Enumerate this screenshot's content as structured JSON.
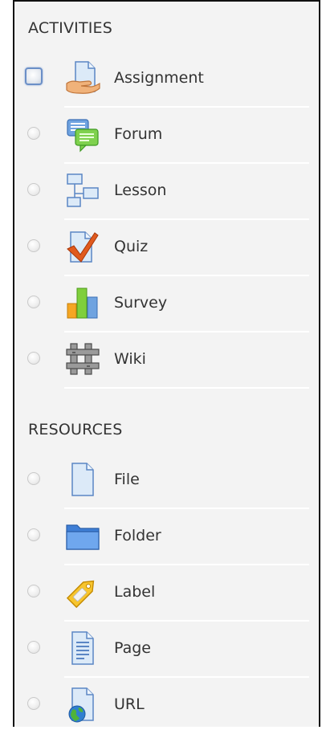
{
  "sections": {
    "activities": {
      "header": "ACTIVITIES",
      "items": [
        {
          "label": "Assignment",
          "icon": "assignment-icon",
          "selected": true
        },
        {
          "label": "Forum",
          "icon": "forum-icon",
          "selected": false
        },
        {
          "label": "Lesson",
          "icon": "lesson-icon",
          "selected": false
        },
        {
          "label": "Quiz",
          "icon": "quiz-icon",
          "selected": false
        },
        {
          "label": "Survey",
          "icon": "survey-icon",
          "selected": false
        },
        {
          "label": "Wiki",
          "icon": "wiki-icon",
          "selected": false
        }
      ]
    },
    "resources": {
      "header": "RESOURCES",
      "items": [
        {
          "label": "File",
          "icon": "file-icon",
          "selected": false
        },
        {
          "label": "Folder",
          "icon": "folder-icon",
          "selected": false
        },
        {
          "label": "Label",
          "icon": "label-icon",
          "selected": false
        },
        {
          "label": "Page",
          "icon": "page-icon",
          "selected": false
        },
        {
          "label": "URL",
          "icon": "url-icon",
          "selected": false
        }
      ]
    }
  },
  "colors": {
    "panel_background": "#f3f3f3",
    "text": "#333333",
    "selected_outline": "#6b8fc7"
  }
}
